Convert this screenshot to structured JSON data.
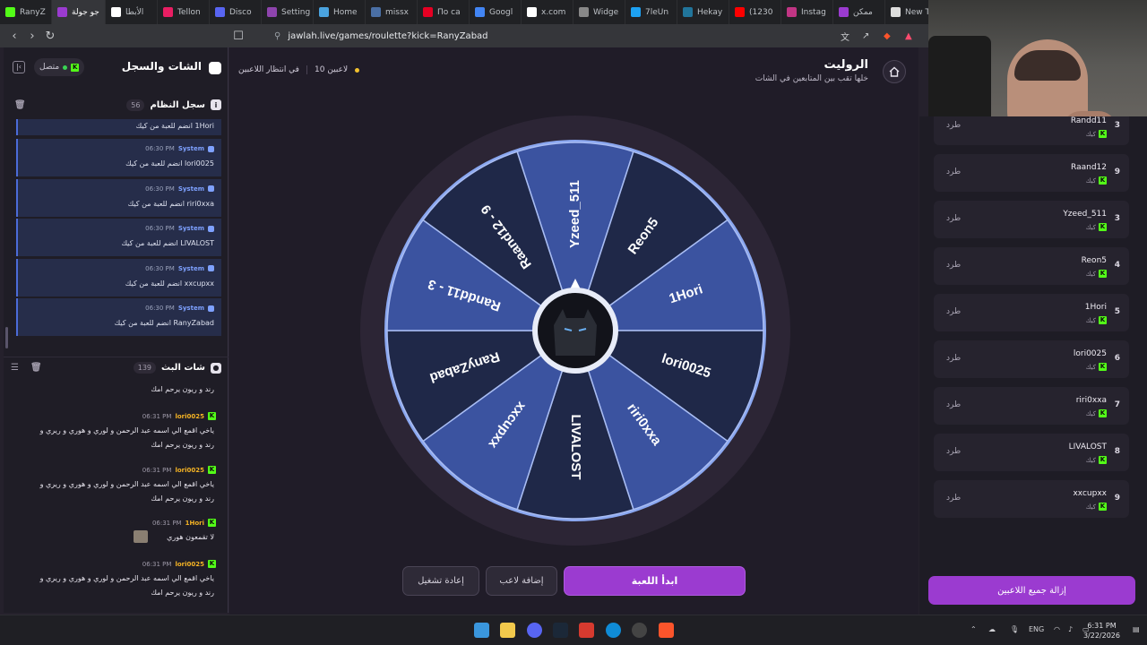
{
  "browser": {
    "tabs": [
      {
        "label": "RanyZ",
        "color": "#53fc18"
      },
      {
        "label": "جو جولة",
        "color": "#9b3bd0",
        "active": true
      },
      {
        "label": "الأبطا",
        "color": "#ffffff"
      },
      {
        "label": "Tellon",
        "color": "#e91e63"
      },
      {
        "label": "Disco",
        "color": "#5865f2"
      },
      {
        "label": "Setting",
        "color": "#8e44ad"
      },
      {
        "label": "Home",
        "color": "#4aa3df"
      },
      {
        "label": "missx",
        "color": "#4a6fa5"
      },
      {
        "label": "По са",
        "color": "#e60023"
      },
      {
        "label": "Googl",
        "color": "#4285f4"
      },
      {
        "label": "x.com",
        "color": "#ffffff"
      },
      {
        "label": "Widge",
        "color": "#888888"
      },
      {
        "label": "7leUn",
        "color": "#1da1f2"
      },
      {
        "label": "Hekay",
        "color": "#21759b"
      },
      {
        "label": "(1230",
        "color": "#ff0000"
      },
      {
        "label": "Instag",
        "color": "#c13584"
      },
      {
        "label": "ممكن",
        "color": "#9b3bd0"
      },
      {
        "label": "New T",
        "color": "#dddddd"
      }
    ],
    "url": "jawlah.live/games/roulette?kick=RanyZabad"
  },
  "left": {
    "title": "الشات والسجل",
    "status": "متصل",
    "syslog": {
      "title": "سجل النظام",
      "count": "56",
      "first_text": "1Hori انضم للعبة من كيك",
      "messages": [
        {
          "who": "System",
          "time": "06:30 PM",
          "text": "lori0025 انضم للعبة من كيك"
        },
        {
          "who": "System",
          "time": "06:30 PM",
          "text": "riri0xxa انضم للعبة من كيك"
        },
        {
          "who": "System",
          "time": "06:30 PM",
          "text": "LIVALOST انضم للعبة من كيك"
        },
        {
          "who": "System",
          "time": "06:30 PM",
          "text": "xxcupxx انضم للعبة من كيك"
        },
        {
          "who": "System",
          "time": "06:30 PM",
          "text": "RanyZabad انضم للعبة من كيك"
        }
      ]
    },
    "chat": {
      "title": "شات البث",
      "count": "139",
      "top_line": "رند و ريون يرحم امك",
      "messages": [
        {
          "who": "lori0025",
          "time": "06:31 PM",
          "lines": [
            "ياخي اقمع الي اسمه عبد الرحمن و لوري و هوري و ريري و",
            "رند و ريون يرحم امك"
          ]
        },
        {
          "who": "lori0025",
          "time": "06:31 PM",
          "lines": [
            "ياخي اقمع الي اسمه عبد الرحمن و لوري و هوري و ريري و",
            "رند و ريون يرحم امك"
          ]
        },
        {
          "who": "1Hori",
          "time": "06:31 PM",
          "lines": [
            "لا تقمعون هوري"
          ]
        },
        {
          "who": "lori0025",
          "time": "06:31 PM",
          "lines": [
            "ياخي اقمع الي اسمه عبد الرحمن و لوري و هوري و ريري و",
            "رند و ريون يرحم امك"
          ]
        }
      ]
    }
  },
  "game": {
    "title": "الروليت",
    "subtitle": "خلها تقب بين المتابعين في الشات",
    "players_count": "10 لاعبين",
    "waiting": "في انتظار اللاعبين",
    "segments": [
      "Yzeed_511",
      "Reon5",
      "1Hori",
      "lori0025",
      "riri0xxa",
      "LIVALOST",
      "xxcupxx",
      "RanyZabad",
      "Randd11 - 3",
      "Raand12 - 9"
    ],
    "buttons": {
      "start": "ابدأ اللعبة",
      "add": "إضافة لاعب",
      "restart": "إعادة تشغيل"
    }
  },
  "players": {
    "kick_label": "طرد",
    "platform": "كيك",
    "remove_all": "إزالة جميع اللاعبين",
    "list": [
      {
        "name": "Randd11",
        "num": "3"
      },
      {
        "name": "Raand12",
        "num": "9"
      },
      {
        "name": "Yzeed_511",
        "num": "3"
      },
      {
        "name": "Reon5",
        "num": "4"
      },
      {
        "name": "1Hori",
        "num": "5"
      },
      {
        "name": "lori0025",
        "num": "6"
      },
      {
        "name": "riri0xxa",
        "num": "7"
      },
      {
        "name": "LIVALOST",
        "num": "8"
      },
      {
        "name": "xxcupxx",
        "num": "9"
      }
    ]
  },
  "taskbar": {
    "lang": "ENG",
    "time": "6:31 PM",
    "date": "3/22/2026"
  }
}
